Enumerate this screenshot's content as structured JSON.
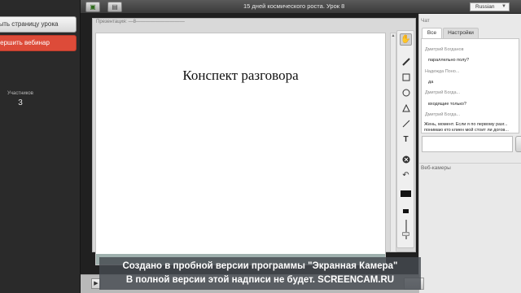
{
  "left_panel": {
    "open_page_button": "рыть страницу урока",
    "end_webinar_button": "вершить вебинар",
    "participants_label": "Участников",
    "participants_count": "3"
  },
  "top_bar": {
    "title": "15 дней космического роста. Урок 8",
    "language": "Russian"
  },
  "presentation": {
    "label": "Презентация: —8——————————",
    "slide_title": "Конспект разговора"
  },
  "tools": [
    {
      "icon": "hand-icon",
      "active": true
    },
    {
      "icon": "pencil-icon"
    },
    {
      "icon": "rectangle-icon"
    },
    {
      "icon": "circle-icon"
    },
    {
      "icon": "triangle-icon"
    },
    {
      "icon": "line-icon"
    },
    {
      "icon": "text-icon",
      "glyph": "T"
    },
    {
      "icon": "clear-icon"
    },
    {
      "icon": "undo-icon"
    }
  ],
  "chat": {
    "header": "Чат",
    "tabs": [
      {
        "label": "Все",
        "active": true
      },
      {
        "label": "Настройки",
        "active": false
      }
    ],
    "messages": [
      {
        "author": "Дмитрий Богданов",
        "text": "параллельно полу?"
      },
      {
        "author": "Надежда Поно...",
        "text": "да"
      },
      {
        "author": "Дмитрий Богда...",
        "text": "входящие только?"
      },
      {
        "author": "Дмитрий Богда...",
        "text": "Жень, момент. Если я по первому разг... понимаю кто клиен мой стоит ли догов..."
      }
    ],
    "webcams_label": "Веб-камеры"
  },
  "watermark": {
    "line1": "Создано в пробной версии программы \"Экранная Камера\"",
    "line2": "В полной версии этой надписи не будет. SCREENCAM.RU"
  },
  "colors": {
    "end_button": "#dd4b39",
    "slide_footer": "#9fb1ae"
  }
}
